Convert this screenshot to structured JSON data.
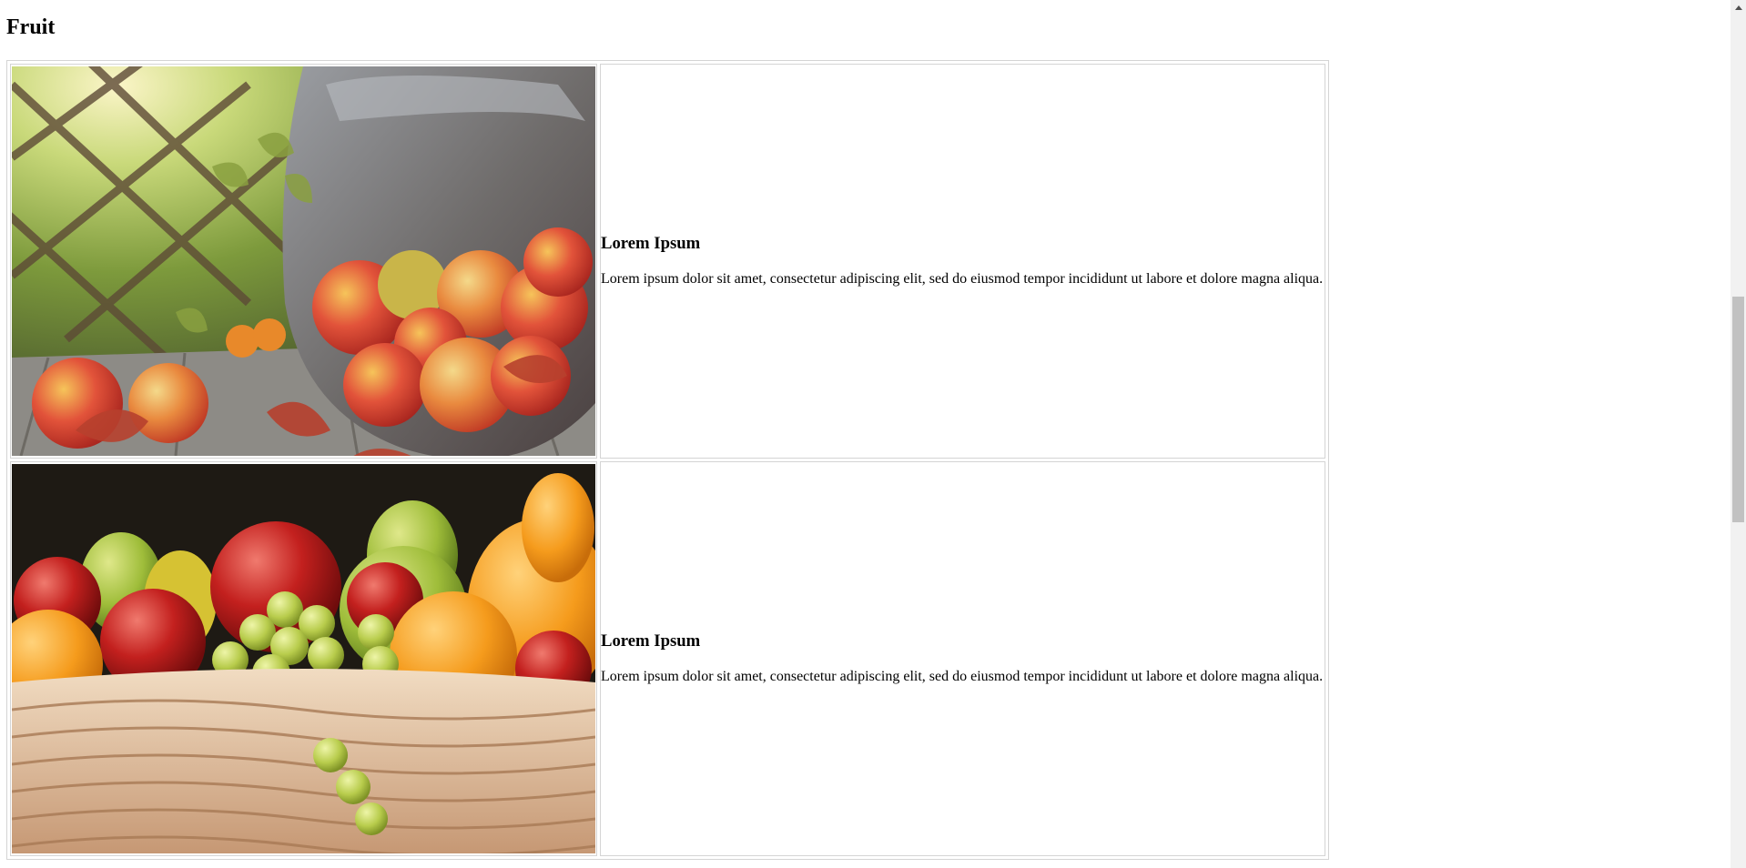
{
  "page": {
    "title": "Fruit"
  },
  "rows": [
    {
      "image_icon": "apples-in-basket-photo",
      "heading": "Lorem Ipsum",
      "text": "Lorem ipsum dolor sit amet, consectetur adipiscing elit, sed do eiusmod tempor incididunt ut labore et dolore magna aliqua."
    },
    {
      "image_icon": "fruit-basket-photo",
      "heading": "Lorem Ipsum",
      "text": "Lorem ipsum dolor sit amet, consectetur adipiscing elit, sed do eiusmod tempor incididunt ut labore et dolore magna aliqua."
    }
  ],
  "colors": {
    "border": "#d4d4d4",
    "scrollbar_track": "#f1f1f1",
    "scrollbar_thumb": "#c1c1c1"
  }
}
